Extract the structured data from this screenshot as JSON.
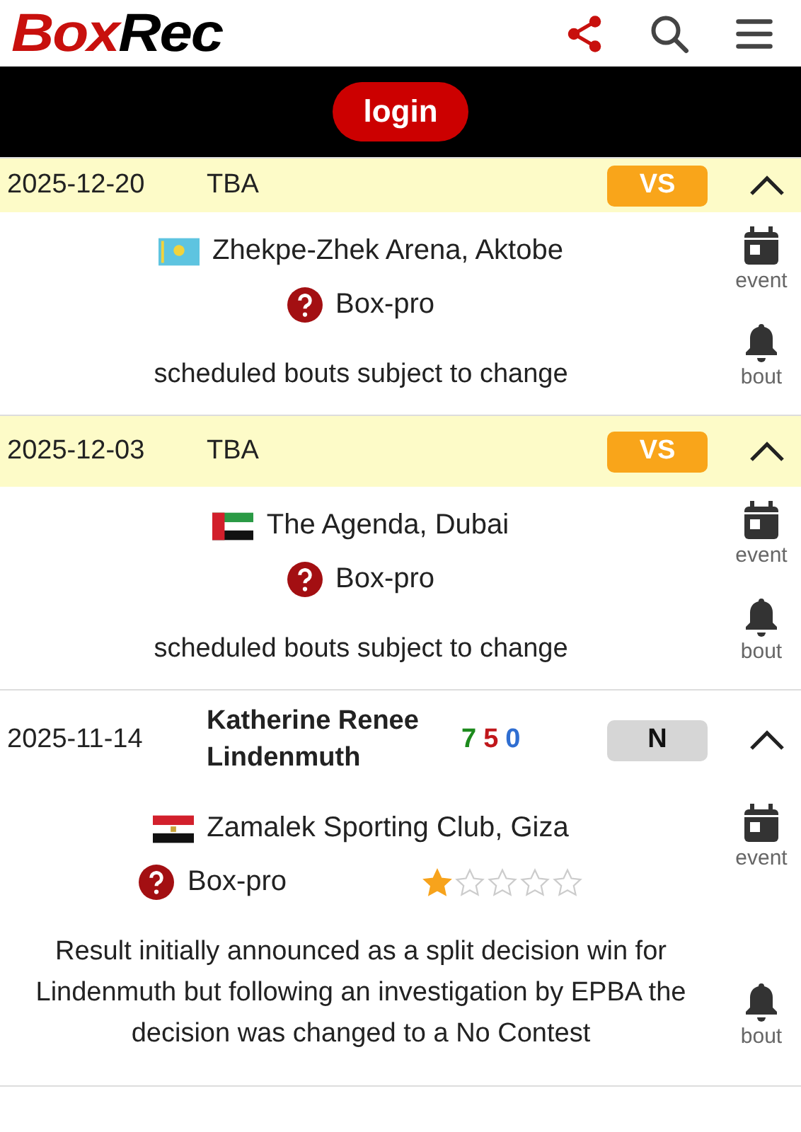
{
  "header": {
    "logo_part_1": "Box",
    "logo_part_2": "Rec"
  },
  "login_button": "login",
  "bouts": [
    {
      "date": "2025-12-20",
      "opponent": "TBA",
      "opponent_bold": false,
      "result": "VS",
      "color": "#f9a51a",
      "highlighted": true,
      "expanded": true,
      "flag": {
        "kind": "kz"
      },
      "venue": "Zhekpe-Zhek Arena, Aktobe",
      "sanction": "Box-pro",
      "note": "scheduled bouts subject to change",
      "event_label": "event",
      "bout_label": "bout"
    },
    {
      "date": "2025-12-03",
      "opponent": "TBA",
      "opponent_bold": false,
      "result": "VS",
      "color": "#f9a51a",
      "highlighted": true,
      "expanded": true,
      "flag": {
        "kind": "ae"
      },
      "venue": "The Agenda, Dubai",
      "sanction": "Box-pro",
      "note": "scheduled bouts subject to change",
      "event_label": "event",
      "bout_label": "bout"
    },
    {
      "date": "2025-11-14",
      "opponent": "Katherine Renee Lindenmuth",
      "opponent_bold": true,
      "record": {
        "wins": "7",
        "losses": "5",
        "draws": "0"
      },
      "result": "N",
      "color": "#d6d6d6",
      "highlighted": false,
      "expanded": true,
      "flag": {
        "kind": "eg"
      },
      "venue": "Zamalek Sporting Club, Giza",
      "sanction": "Box-pro",
      "stars": 1,
      "note": "Result initially announced as a split decision win for Lindenmuth but following an investigation by EPBA the decision was changed to a No Contest",
      "event_label": "event",
      "bout_label": "bout"
    }
  ]
}
